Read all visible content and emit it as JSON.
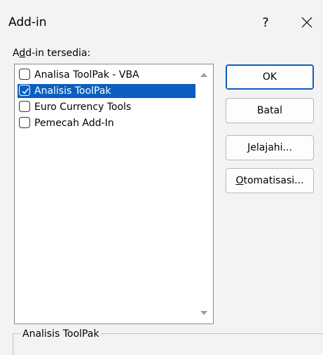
{
  "dialog": {
    "title": "Add-in",
    "help_label": "?"
  },
  "addins": {
    "label_prefix": "A",
    "label_hotkey": "d",
    "label_rest": "d-in tersedia:",
    "items": [
      {
        "label": "Analisa ToolPak - VBA",
        "checked": false,
        "selected": false
      },
      {
        "label": "Analisis ToolPak",
        "checked": true,
        "selected": true
      },
      {
        "label": "Euro Currency Tools",
        "checked": false,
        "selected": false
      },
      {
        "label": "Pemecah Add-In",
        "checked": false,
        "selected": false
      }
    ]
  },
  "buttons": {
    "ok": "OK",
    "cancel": "Batal",
    "browse_hotkey": "J",
    "browse_rest": "elajahi...",
    "automation_hotkey": "O",
    "automation_rest": "tomatisasi..."
  },
  "description": {
    "title": "Analisis ToolPak"
  },
  "colors": {
    "selection": "#0a5fbf",
    "background": "#f3f3f3"
  }
}
